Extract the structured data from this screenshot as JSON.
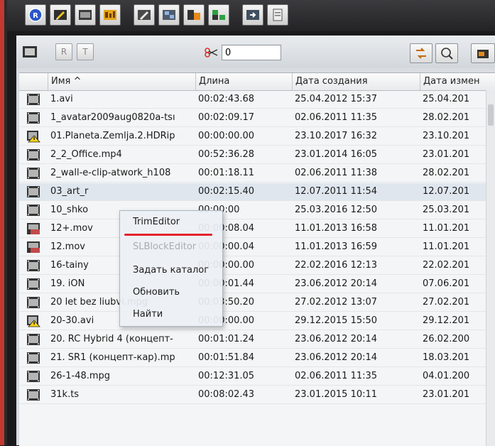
{
  "toolbar": {
    "buttons": [
      {
        "name": "record-icon"
      },
      {
        "name": "edit-icon"
      },
      {
        "name": "timeline-icon"
      },
      {
        "name": "audio-icon"
      },
      {
        "name": "render-icon"
      },
      {
        "name": "grid-icon"
      },
      {
        "name": "trim-icon"
      },
      {
        "name": "split-icon"
      },
      {
        "name": "export-icon"
      },
      {
        "name": "document-icon"
      }
    ]
  },
  "browser_toolbar": {
    "filter_value": "0",
    "buttons": [
      {
        "name": "r-icon",
        "label": "R"
      },
      {
        "name": "t-icon",
        "label": "T"
      }
    ]
  },
  "table": {
    "columns": [
      "Имя ^",
      "Длина",
      "Дата создания",
      "Дата измен"
    ],
    "rows": [
      {
        "icon": "film",
        "name": "1.avi",
        "length": "00:02:43.68",
        "created": "25.04.2012 15:37",
        "modified": "25.04.201"
      },
      {
        "icon": "film",
        "name": "1_avatar2009aug0820a-tsı",
        "length": "00:02:09.17",
        "created": "02.06.2011 11:35",
        "modified": "28.02.201"
      },
      {
        "icon": "warn",
        "name": "01.Planeta.Zemlja.2.HDRip",
        "length": "00:00:00.00",
        "created": "23.10.2017 16:32",
        "modified": "23.10.201"
      },
      {
        "icon": "film",
        "name": "2_2_Office.mp4",
        "length": "00:52:36.28",
        "created": "23.01.2014 16:05",
        "modified": "23.01.201"
      },
      {
        "icon": "film",
        "name": "2_wall-e-clip-atwork_h108",
        "length": "00:01:18.11",
        "created": "02.06.2011 11:38",
        "modified": "28.02.201"
      },
      {
        "icon": "film",
        "name": "03_art_r",
        "length": "00:02:15.40",
        "created": "12.07.2011 11:54",
        "modified": "12.07.201",
        "selected": true
      },
      {
        "icon": "film",
        "name": "10_shko",
        "length": "00:00:00",
        "created": "25.03.2016 12:50",
        "modified": "25.03.201"
      },
      {
        "icon": "filmred",
        "name": "12+.mov",
        "length": "00:00:08.04",
        "created": "11.01.2013 16:58",
        "modified": "11.01.201"
      },
      {
        "icon": "filmred",
        "name": "12.mov",
        "length": "00:00:00.04",
        "created": "11.01.2013 16:59",
        "modified": "11.01.201"
      },
      {
        "icon": "film",
        "name": "16-tainy",
        "length": "00:00:00.00",
        "created": "22.02.2016 12:13",
        "modified": "22.02.201"
      },
      {
        "icon": "film",
        "name": "19. iON",
        "length": "00:00:01.44",
        "created": "23.06.2012 20:14",
        "modified": "07.06.201"
      },
      {
        "icon": "film",
        "name": "20 let bez liubvi.mpg",
        "length": "00:03:50.20",
        "created": "27.02.2012 13:07",
        "modified": "27.02.201"
      },
      {
        "icon": "warn",
        "name": "20-30.avi",
        "length": "00:00:00.00",
        "created": "29.12.2015 15:50",
        "modified": "29.12.201"
      },
      {
        "icon": "film",
        "name": "20. RC Hybrid 4 (концепт-",
        "length": "00:01:01.24",
        "created": "23.06.2012 20:14",
        "modified": "26.02.200"
      },
      {
        "icon": "film",
        "name": "21. SR1 (концепт-кар).mp",
        "length": "00:01:51.84",
        "created": "23.06.2012 20:14",
        "modified": "18.03.201"
      },
      {
        "icon": "film",
        "name": "26-1-48.mpg",
        "length": "00:12:31.05",
        "created": "02.06.2011 11:35",
        "modified": "04.01.200"
      },
      {
        "icon": "film",
        "name": "31k.ts",
        "length": "00:08:02.43",
        "created": "23.01.2015 10:11",
        "modified": "23.01.201"
      }
    ]
  },
  "context_menu": {
    "items": [
      {
        "label": "TrimEditor",
        "disabled": false
      },
      {
        "label": "SLBlockEditor",
        "disabled": true
      },
      {
        "label": "Задать каталог",
        "disabled": false
      },
      {
        "label": "Обновить",
        "disabled": false
      },
      {
        "label": "Найти",
        "disabled": false
      }
    ]
  },
  "colors": {
    "accent_red": "#e3222c",
    "selection": "#dfe6ee"
  }
}
